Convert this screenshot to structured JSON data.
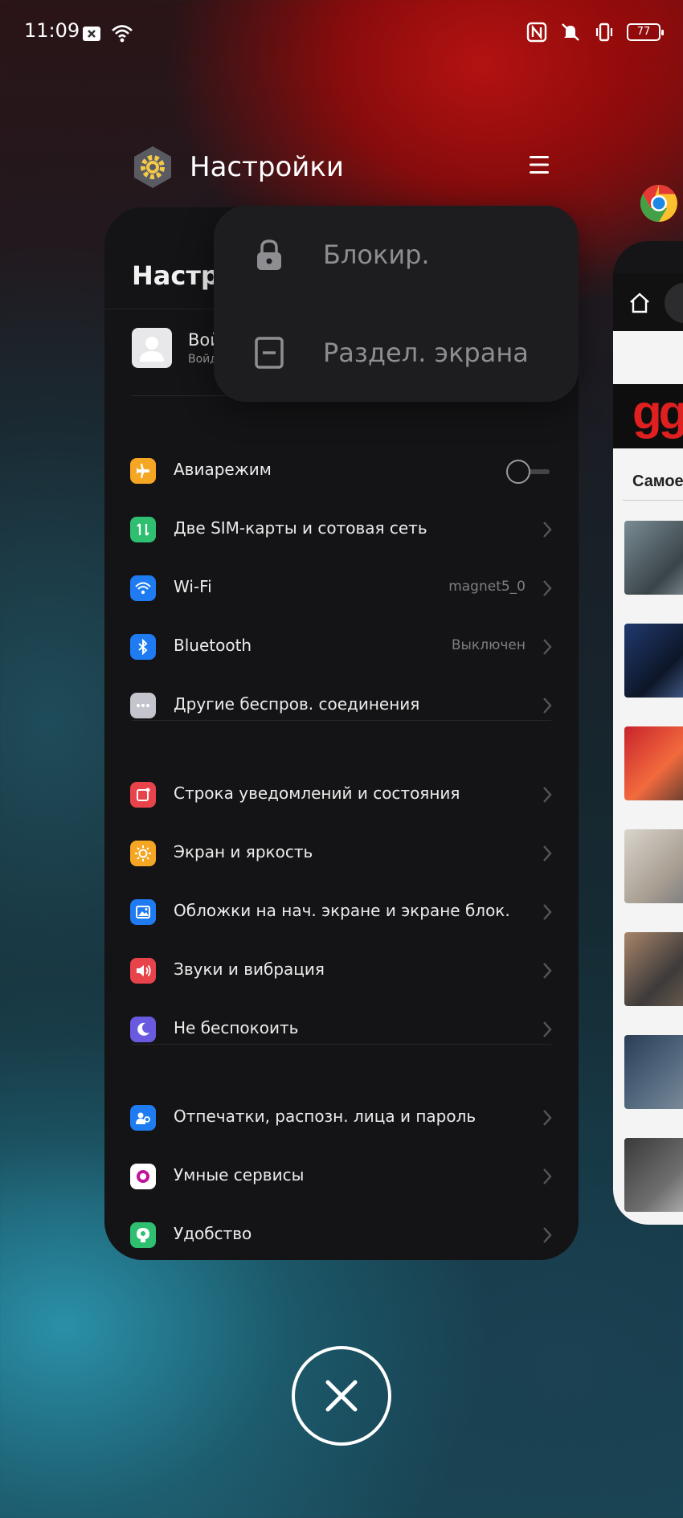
{
  "status": {
    "time": "11:09",
    "battery": "77"
  },
  "recent_app": {
    "title": "Настройки"
  },
  "settings_card": {
    "title_partial": "Настро",
    "account": {
      "name_partial": "Вой",
      "sub_partial": "Войд"
    },
    "items": [
      {
        "label": "Авиарежим",
        "value": "",
        "icon": "airplane-icon",
        "color": "#f5a623"
      },
      {
        "label": "Две SIM-карты и сотовая сеть",
        "value": "",
        "icon": "sim-icon",
        "color": "#2fbf71"
      },
      {
        "label": "Wi-Fi",
        "value": "magnet5_0",
        "icon": "wifi-icon",
        "color": "#1e7bf2"
      },
      {
        "label": "Bluetooth",
        "value": "Выключен",
        "icon": "bluetooth-icon",
        "color": "#1e7bf2"
      },
      {
        "label": "Другие беспров. соединения",
        "value": "",
        "icon": "more-icon",
        "color": "#c4c4cc"
      },
      {
        "label": "Строка уведомлений и состояния",
        "value": "",
        "icon": "notification-icon",
        "color": "#e8434b"
      },
      {
        "label": "Экран и яркость",
        "value": "",
        "icon": "brightness-icon",
        "color": "#f5a623"
      },
      {
        "label": "Обложки на нач. экране и экране блок.",
        "value": "",
        "icon": "wallpaper-icon",
        "color": "#1e7bf2"
      },
      {
        "label": "Звуки и вибрация",
        "value": "",
        "icon": "sound-icon",
        "color": "#e8434b"
      },
      {
        "label": "Не беспокоить",
        "value": "",
        "icon": "moon-icon",
        "color": "#6a5ae0"
      },
      {
        "label": "Отпечатки, распозн. лица и пароль",
        "value": "",
        "icon": "face-id-icon",
        "color": "#1e7bf2"
      },
      {
        "label": "Умные сервисы",
        "value": "",
        "icon": "smart-services-icon",
        "color": "#ffffff"
      },
      {
        "label": "Удобство",
        "value": "",
        "icon": "convenience-icon",
        "color": "#2fbf71"
      }
    ]
  },
  "popup_menu": {
    "lock_label": "Блокир.",
    "split_label": "Раздел. экрана"
  },
  "browser_card": {
    "logo_partial": "gg",
    "heading_partial": "Самое"
  }
}
